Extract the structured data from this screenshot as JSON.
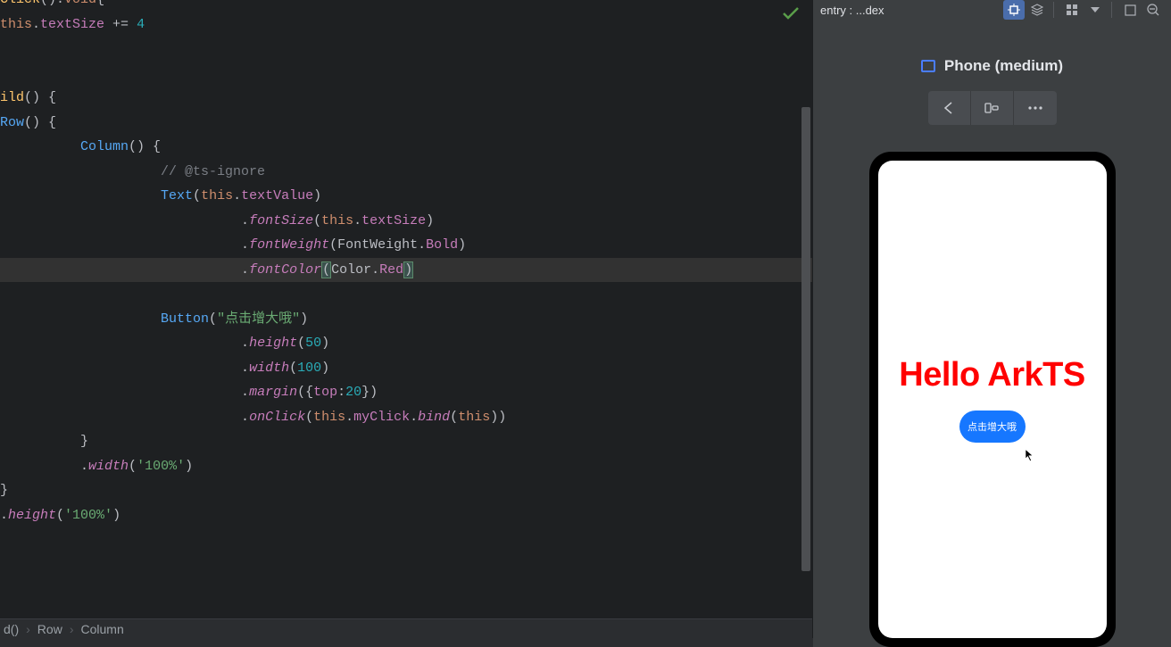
{
  "editor": {
    "status_icon": "check",
    "lines": {
      "l0a": {
        "indent": 0,
        "parts": [
          {
            "t": "Click",
            "c": "decl"
          },
          {
            "t": "()",
            "c": "paren"
          },
          {
            "t": ":",
            "c": "op"
          },
          {
            "t": "void",
            "c": "kw"
          },
          {
            "t": "{",
            "c": "brace"
          }
        ]
      },
      "l0": {
        "indent": 0,
        "parts": [
          {
            "t": "this",
            "c": "kw"
          },
          {
            "t": ".",
            "c": "op"
          },
          {
            "t": "textSize",
            "c": "prop"
          },
          {
            "t": " += ",
            "c": "op"
          },
          {
            "t": "4",
            "c": "num"
          }
        ]
      },
      "l1": {
        "indent": 0,
        "parts": []
      },
      "l1b": {
        "indent": 0,
        "parts": []
      },
      "l2": {
        "indent": 0,
        "parts": [
          {
            "t": "ild",
            "c": "decl"
          },
          {
            "t": "() {",
            "c": "paren"
          }
        ]
      },
      "l3": {
        "indent": 0,
        "parts": [
          {
            "t": "Row",
            "c": "func"
          },
          {
            "t": "() {",
            "c": "paren"
          }
        ]
      },
      "l4": {
        "indent": 2,
        "parts": [
          {
            "t": "Column",
            "c": "func"
          },
          {
            "t": "() {",
            "c": "paren"
          }
        ]
      },
      "l5": {
        "indent": 4,
        "parts": [
          {
            "t": "// @ts-ignore",
            "c": "comment"
          }
        ]
      },
      "l6": {
        "indent": 4,
        "parts": [
          {
            "t": "Text",
            "c": "func"
          },
          {
            "t": "(",
            "c": "paren"
          },
          {
            "t": "this",
            "c": "kw"
          },
          {
            "t": ".",
            "c": "op"
          },
          {
            "t": "textValue",
            "c": "prop"
          },
          {
            "t": ")",
            "c": "paren"
          }
        ]
      },
      "l7": {
        "indent": 6,
        "parts": [
          {
            "t": ".",
            "c": "op"
          },
          {
            "t": "fontSize",
            "c": "method"
          },
          {
            "t": "(",
            "c": "paren"
          },
          {
            "t": "this",
            "c": "kw"
          },
          {
            "t": ".",
            "c": "op"
          },
          {
            "t": "textSize",
            "c": "prop"
          },
          {
            "t": ")",
            "c": "paren"
          }
        ]
      },
      "l8": {
        "indent": 6,
        "parts": [
          {
            "t": ".",
            "c": "op"
          },
          {
            "t": "fontWeight",
            "c": "method"
          },
          {
            "t": "(",
            "c": "paren"
          },
          {
            "t": "FontWeight",
            "c": "type"
          },
          {
            "t": ".",
            "c": "op"
          },
          {
            "t": "Bold",
            "c": "prop"
          },
          {
            "t": ")",
            "c": "paren"
          }
        ]
      },
      "l9": {
        "indent": 6,
        "highlight": true,
        "parts": [
          {
            "t": ".",
            "c": "op"
          },
          {
            "t": "fontColor",
            "c": "method"
          },
          {
            "t": "(",
            "c": "paren",
            "m": true
          },
          {
            "t": "Color",
            "c": "type"
          },
          {
            "t": ".",
            "c": "op"
          },
          {
            "t": "Red",
            "c": "prop"
          },
          {
            "t": ")",
            "c": "paren",
            "m": true
          }
        ]
      },
      "l10": {
        "indent": 0,
        "parts": []
      },
      "l11": {
        "indent": 4,
        "parts": [
          {
            "t": "Button",
            "c": "func"
          },
          {
            "t": "(",
            "c": "paren"
          },
          {
            "t": "\"点击增大哦\"",
            "c": "str"
          },
          {
            "t": ")",
            "c": "paren"
          }
        ]
      },
      "l12": {
        "indent": 6,
        "parts": [
          {
            "t": ".",
            "c": "op"
          },
          {
            "t": "height",
            "c": "method"
          },
          {
            "t": "(",
            "c": "paren"
          },
          {
            "t": "50",
            "c": "num"
          },
          {
            "t": ")",
            "c": "paren"
          }
        ]
      },
      "l13": {
        "indent": 6,
        "parts": [
          {
            "t": ".",
            "c": "op"
          },
          {
            "t": "width",
            "c": "method"
          },
          {
            "t": "(",
            "c": "paren"
          },
          {
            "t": "100",
            "c": "num"
          },
          {
            "t": ")",
            "c": "paren"
          }
        ]
      },
      "l14": {
        "indent": 6,
        "parts": [
          {
            "t": ".",
            "c": "op"
          },
          {
            "t": "margin",
            "c": "method"
          },
          {
            "t": "(",
            "c": "paren"
          },
          {
            "t": "{",
            "c": "brace"
          },
          {
            "t": "top",
            "c": "prop"
          },
          {
            "t": ":",
            "c": "op"
          },
          {
            "t": "20",
            "c": "num"
          },
          {
            "t": "}",
            "c": "brace"
          },
          {
            "t": ")",
            "c": "paren"
          }
        ]
      },
      "l15": {
        "indent": 6,
        "parts": [
          {
            "t": ".",
            "c": "op"
          },
          {
            "t": "onClick",
            "c": "method"
          },
          {
            "t": "(",
            "c": "paren"
          },
          {
            "t": "this",
            "c": "kw"
          },
          {
            "t": ".",
            "c": "op"
          },
          {
            "t": "myClick",
            "c": "prop"
          },
          {
            "t": ".",
            "c": "op"
          },
          {
            "t": "bind",
            "c": "method"
          },
          {
            "t": "(",
            "c": "paren"
          },
          {
            "t": "this",
            "c": "kw"
          },
          {
            "t": ")",
            "c": "paren"
          },
          {
            "t": ")",
            "c": "paren"
          }
        ]
      },
      "l16": {
        "indent": 2,
        "parts": [
          {
            "t": "}",
            "c": "brace"
          }
        ]
      },
      "l17": {
        "indent": 2,
        "parts": [
          {
            "t": ".",
            "c": "op"
          },
          {
            "t": "width",
            "c": "method"
          },
          {
            "t": "(",
            "c": "paren"
          },
          {
            "t": "'100%'",
            "c": "str"
          },
          {
            "t": ")",
            "c": "paren"
          }
        ]
      },
      "l18": {
        "indent": 0,
        "parts": [
          {
            "t": "}",
            "c": "brace"
          }
        ]
      },
      "l19": {
        "indent": 0,
        "parts": [
          {
            "t": ".",
            "c": "op"
          },
          {
            "t": "height",
            "c": "method"
          },
          {
            "t": "(",
            "c": "paren"
          },
          {
            "t": "'100%'",
            "c": "str"
          },
          {
            "t": ")",
            "c": "paren"
          }
        ]
      }
    },
    "line_order": [
      "l0a",
      "l0",
      "l1",
      "l1b",
      "l2",
      "l3",
      "l4",
      "l5",
      "l6",
      "l7",
      "l8",
      "l9",
      "l10",
      "l11",
      "l12",
      "l13",
      "l14",
      "l15",
      "l16",
      "l17",
      "l18",
      "l19"
    ]
  },
  "breadcrumb": {
    "items": [
      "d()",
      "Row",
      "Column"
    ]
  },
  "preview": {
    "header_title": "entry : ...dex",
    "device_label": "Phone (medium)",
    "phone": {
      "text": "Hello ArkTS",
      "button_label": "点击增大哦"
    }
  }
}
